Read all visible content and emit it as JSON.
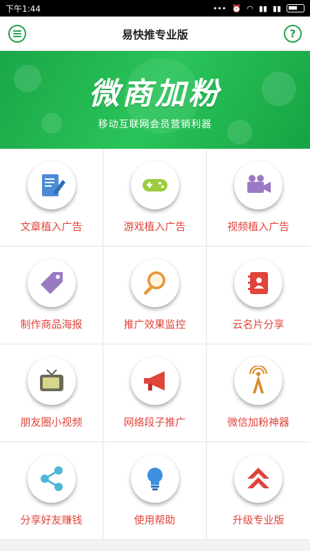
{
  "status": {
    "time": "下午1:44"
  },
  "appbar": {
    "title": "易快推专业版",
    "help_symbol": "?"
  },
  "banner": {
    "headline": "微商加粉",
    "subtitle": "移动互联网会员营销利器"
  },
  "tiles": [
    {
      "label": "文章植入广告",
      "icon": "article-edit-icon"
    },
    {
      "label": "游戏植入广告",
      "icon": "gamepad-icon"
    },
    {
      "label": "视频植入广告",
      "icon": "video-camera-icon"
    },
    {
      "label": "制作商品海报",
      "icon": "tag-icon"
    },
    {
      "label": "推广效果监控",
      "icon": "magnifier-icon"
    },
    {
      "label": "云名片分享",
      "icon": "contact-book-icon"
    },
    {
      "label": "朋友圈小视频",
      "icon": "tv-icon"
    },
    {
      "label": "网络段子推广",
      "icon": "megaphone-icon"
    },
    {
      "label": "微信加粉神器",
      "icon": "signal-tower-icon"
    },
    {
      "label": "分享好友赚钱",
      "icon": "share-icon"
    },
    {
      "label": "使用帮助",
      "icon": "lightbulb-icon"
    },
    {
      "label": "升级专业版",
      "icon": "upgrade-arrow-icon"
    }
  ]
}
